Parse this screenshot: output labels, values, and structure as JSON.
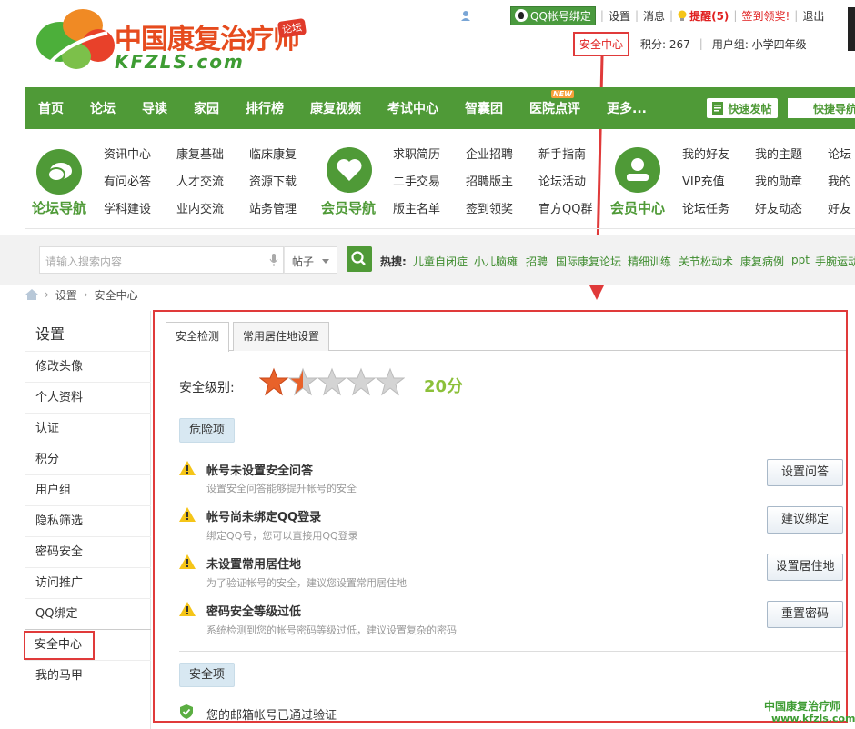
{
  "logo": {
    "cn": "中国康复治疗师",
    "tag": "论坛",
    "en": "KFZLS.com"
  },
  "topbar": {
    "user": "",
    "qq_bind": "QQ帐号绑定",
    "settings": "设置",
    "messages": "消息",
    "remind": "提醒(5)",
    "sign": "签到领奖!",
    "logout": "退出"
  },
  "row2": {
    "security": "安全中心",
    "points": "积分: 267",
    "group": "用户组: 小学四年级"
  },
  "nav": {
    "items": [
      "首页",
      "论坛",
      "导读",
      "家园",
      "排行榜",
      "康复视频",
      "考试中心",
      "智囊团",
      "医院点评",
      "更多..."
    ],
    "new_tag": "NEW",
    "quick_post": "快速发帖",
    "quick_nav": "快捷导航"
  },
  "subnav": {
    "forum_caption": "论坛导航",
    "member_caption": "会员导航",
    "center_caption": "会员中心",
    "g1": [
      "资讯中心",
      "康复基础",
      "临床康复",
      "有问必答",
      "人才交流",
      "资源下载",
      "学科建设",
      "业内交流",
      "站务管理"
    ],
    "g2": [
      "求职简历",
      "企业招聘",
      "新手指南",
      "二手交易",
      "招聘版主",
      "论坛活动",
      "版主名单",
      "签到领奖",
      "官方QQ群"
    ],
    "g3": [
      "我的好友",
      "我的主题",
      "论坛",
      "VIP充值",
      "我的勋章",
      "我的",
      "论坛任务",
      "好友动态",
      "好友"
    ]
  },
  "search": {
    "placeholder": "请输入搜索内容",
    "type": "帖子",
    "hot_label": "热搜:",
    "hot": [
      "儿童自闭症",
      "小儿脑瘫",
      "招聘",
      "国际康复论坛",
      "精细训练",
      "关节松动术",
      "康复病例",
      "ppt",
      "手腕运动"
    ]
  },
  "breadcrumb": {
    "settings": "设置",
    "current": "安全中心"
  },
  "sidebar": {
    "title": "设置",
    "items": [
      "修改头像",
      "个人资料",
      "认证",
      "积分",
      "用户组",
      "隐私筛选",
      "密码安全",
      "访问推广",
      "QQ绑定",
      "安全中心",
      "我的马甲"
    ]
  },
  "tabs": [
    "安全检测",
    "常用居住地设置"
  ],
  "security": {
    "level_label": "安全级别:",
    "score": "20分",
    "stars_filled": 1.5,
    "stars_total": 5,
    "danger_label": "危险项",
    "safe_label": "安全项",
    "warnings": [
      {
        "title": "帐号未设置安全问答",
        "desc": "设置安全问答能够提升帐号的安全",
        "button": "设置问答"
      },
      {
        "title": "帐号尚未绑定QQ登录",
        "desc": "绑定QQ号，您可以直接用QQ登录",
        "button": "建议绑定"
      },
      {
        "title": "未设置常用居住地",
        "desc": "为了验证帐号的安全，建议您设置常用居住地",
        "button": "设置居住地"
      },
      {
        "title": "密码安全等级过低",
        "desc": "系统检测到您的帐号密码等级过低，建议设置复杂的密码",
        "button": "重置密码"
      }
    ],
    "verified": "您的邮箱帐号已通过验证"
  },
  "watermark": {
    "cn": "中国康复治疗师",
    "url": "www.kfzls.com"
  },
  "colors": {
    "green": "#4f9a37",
    "red": "#e03a3a",
    "score": "#8cc03a"
  }
}
